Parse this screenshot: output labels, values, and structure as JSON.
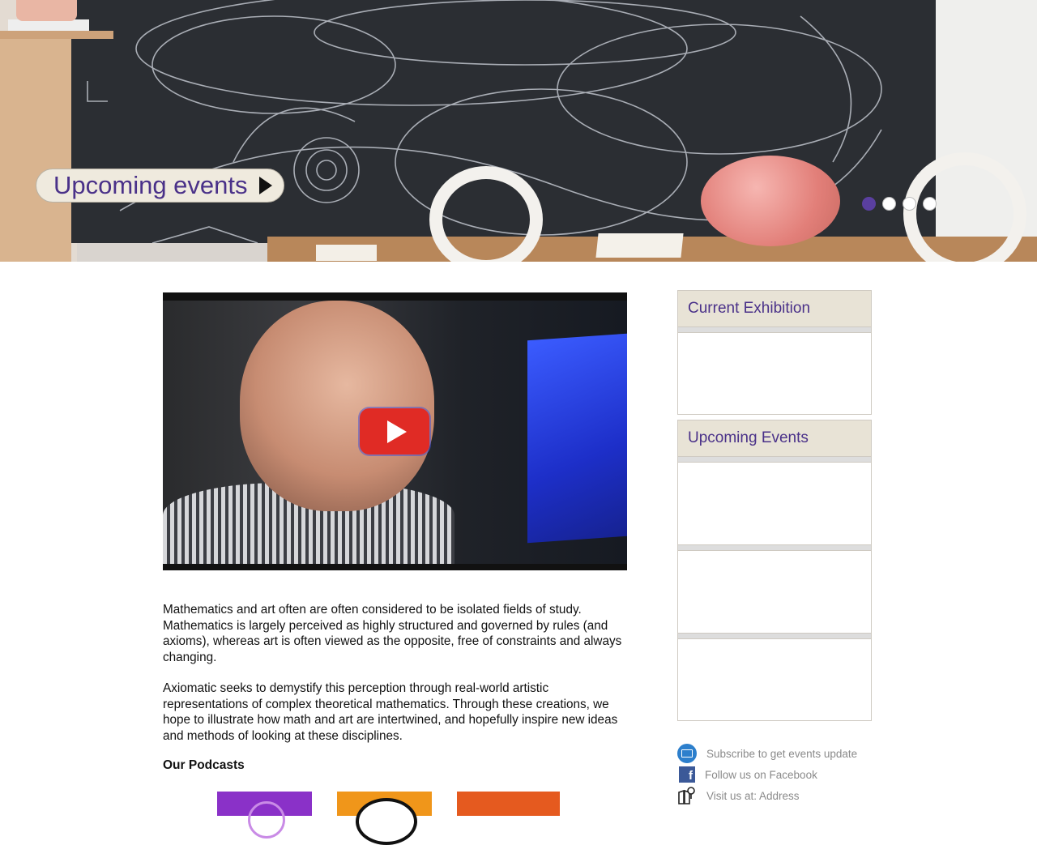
{
  "hero": {
    "button_label": "Upcoming events",
    "slides": [
      "slide-1",
      "slide-2",
      "slide-3",
      "slide-4"
    ],
    "active_slide": 1
  },
  "video": {
    "play_icon": "play-icon"
  },
  "intro": {
    "paragraph_1": "Mathematics and art often are often considered to be isolated fields of study. Mathematics is largely perceived as highly structured and governed by rules (and axioms), whereas art is often viewed as the opposite, free of constraints and always changing.",
    "paragraph_2": "Axiomatic seeks to demystify this perception through real-world artistic representations of complex theoretical mathematics. Through these creations, we hope to illustrate how math and art are intertwined, and hopefully inspire new ideas and methods of looking at these disciplines."
  },
  "podcasts": {
    "title": "Our Podcasts"
  },
  "sidebar": {
    "current_exhibition_title": "Current Exhibition",
    "upcoming_events_title": "Upcoming Events"
  },
  "links": {
    "subscribe": "Subscribe to get events update",
    "facebook": "Follow us on Facebook",
    "visit": "Visit us at: Address"
  },
  "colors": {
    "accent_purple": "#4a3189",
    "panel_header": "#e8e3d6",
    "play_red": "#e02b25"
  }
}
